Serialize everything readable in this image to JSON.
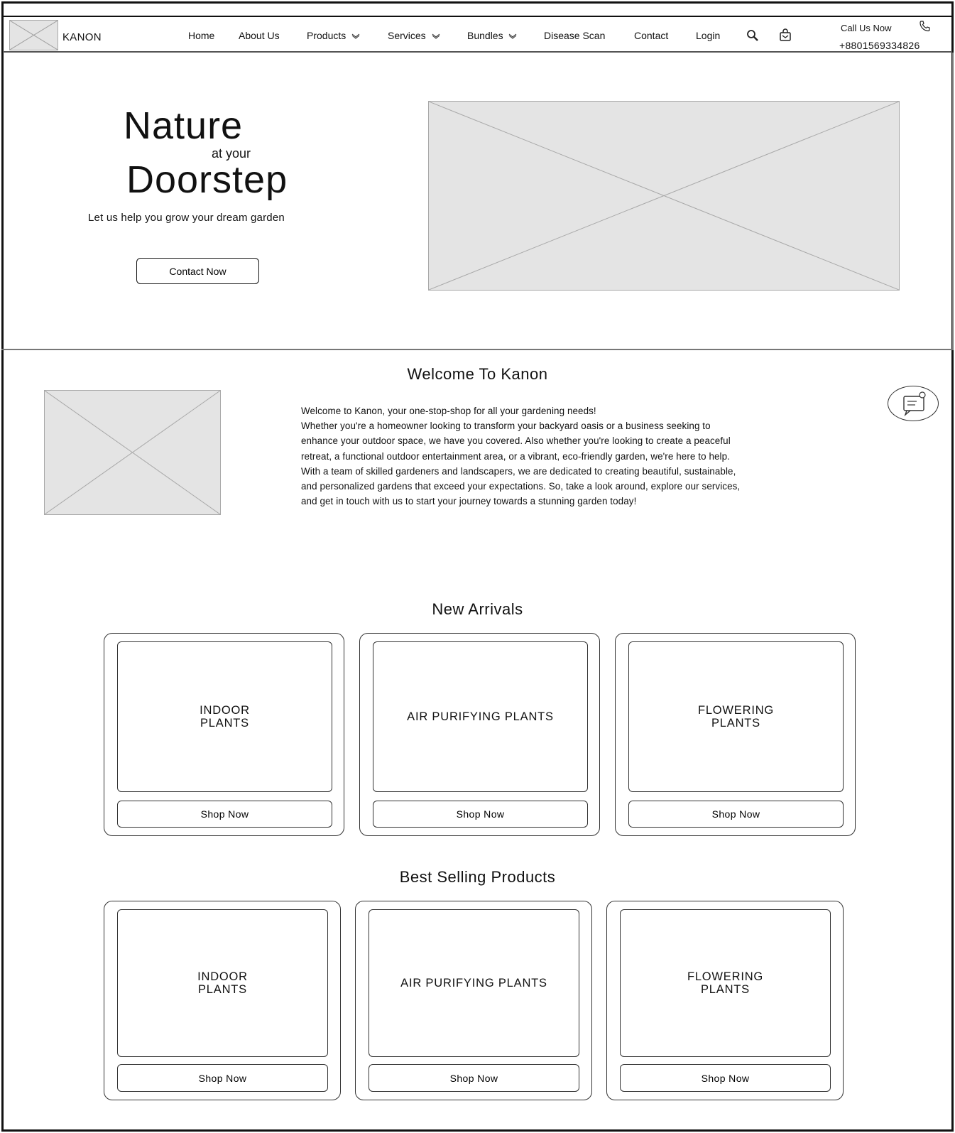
{
  "header": {
    "brand": "KANON",
    "nav": {
      "home": "Home",
      "about": "About Us",
      "products": "Products",
      "services": "Services",
      "bundles": "Bundles",
      "disease_scan": "Disease Scan",
      "contact": "Contact",
      "login": "Login"
    },
    "call_label": "Call Us Now",
    "phone": "+8801569334826",
    "icons": [
      "search-icon",
      "cart-icon",
      "phone-icon",
      "chevron-down-icon"
    ]
  },
  "hero": {
    "line1": "Nature",
    "line2": "at your",
    "line3": "Doorstep",
    "subtitle": "Let us help you grow your dream garden",
    "cta": "Contact Now"
  },
  "welcome": {
    "title": "Welcome To Kanon",
    "lines": [
      "Welcome to Kanon, your one-stop-shop for all your gardening needs!",
      "Whether you're a homeowner looking to transform your backyard oasis or a business seeking to",
      "enhance your outdoor space, we have you covered. Also whether you're looking to create a peaceful",
      "retreat, a functional outdoor entertainment area, or a vibrant, eco-friendly garden, we're here to help.",
      "With a team of skilled gardeners and landscapers, we are dedicated to creating beautiful, sustainable,",
      "and personalized gardens that exceed your expectations. So, take a look around, explore our services,",
      "and get in touch with us to start your journey towards a stunning garden today!"
    ]
  },
  "new_arrivals": {
    "title": "New Arrivals",
    "items": [
      {
        "label": "INDOOR\nPLANTS",
        "button": "Shop Now"
      },
      {
        "label": "AIR PURIFYING PLANTS",
        "button": "Shop Now"
      },
      {
        "label": "FLOWERING\nPLANTS",
        "button": "Shop Now"
      }
    ]
  },
  "best_selling": {
    "title": "Best Selling Products",
    "items": [
      {
        "label": "INDOOR\nPLANTS",
        "button": "Shop Now"
      },
      {
        "label": "AIR PURIFYING PLANTS",
        "button": "Shop Now"
      },
      {
        "label": "FLOWERING\nPLANTS",
        "button": "Shop Now"
      }
    ]
  },
  "colors": {
    "placeholder_fill": "#e4e4e4",
    "placeholder_line": "#a8a8a8",
    "border": "#111111"
  }
}
